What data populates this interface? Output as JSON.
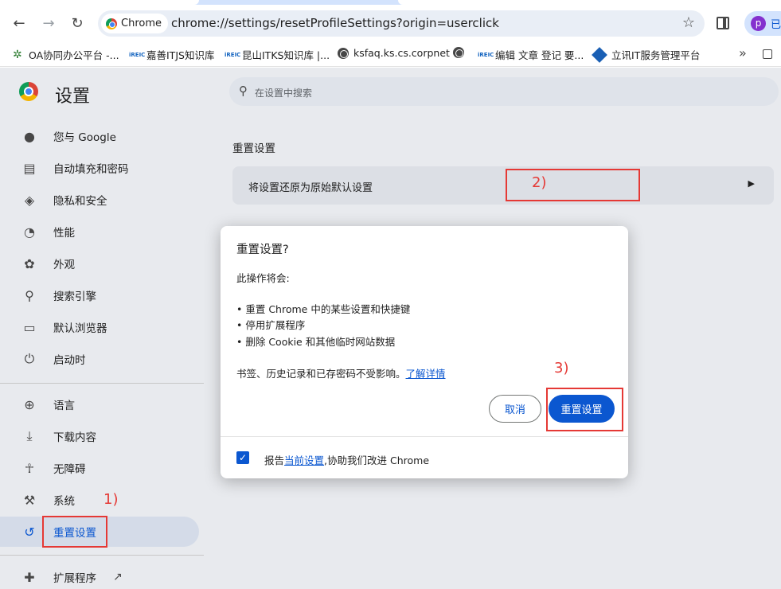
{
  "browser": {
    "chip_label": "Chrome",
    "url": "chrome://settings/resetProfileSettings?origin=userclick",
    "profile_initial": "p",
    "profile_text": "已",
    "icons": {
      "back": "back-arrow-icon",
      "forward": "forward-arrow-icon",
      "reload": "reload-icon",
      "star": "star-icon",
      "side_panel": "side-panel-icon"
    }
  },
  "bookmarks": [
    {
      "label": "OA协同办公平台 -...",
      "icon": "gear-icon"
    },
    {
      "label": "嘉善ITJS知识库",
      "icon": "ireic-icon"
    },
    {
      "label": "昆山ITKS知识库 |...",
      "icon": "ireic-icon"
    },
    {
      "label": "ksfaq.ks.cs.corpnet",
      "icon": "globe-icon"
    },
    {
      "label": "",
      "icon": "globe-icon"
    },
    {
      "label": "编辑 文章 登记 要...",
      "icon": "ireic-icon"
    },
    {
      "label": "立讯IT服务管理平台",
      "icon": "diamond-icon"
    }
  ],
  "bookmarks_more": "»",
  "sidebar": {
    "title": "设置",
    "items": [
      {
        "label": "您与 Google",
        "icon": "person-icon"
      },
      {
        "label": "自动填充和密码",
        "icon": "clipboard-icon"
      },
      {
        "label": "隐私和安全",
        "icon": "shield-icon"
      },
      {
        "label": "性能",
        "icon": "gauge-icon"
      },
      {
        "label": "外观",
        "icon": "palette-icon"
      },
      {
        "label": "搜索引擎",
        "icon": "search-icon"
      },
      {
        "label": "默认浏览器",
        "icon": "browser-icon"
      },
      {
        "label": "启动时",
        "icon": "power-icon"
      },
      {
        "label": "语言",
        "icon": "globe-icon"
      },
      {
        "label": "下载内容",
        "icon": "download-icon"
      },
      {
        "label": "无障碍",
        "icon": "accessibility-icon"
      },
      {
        "label": "系统",
        "icon": "wrench-icon"
      },
      {
        "label": "重置设置",
        "icon": "history-icon"
      },
      {
        "label": "扩展程序",
        "icon": "puzzle-icon"
      }
    ],
    "active_index": 12
  },
  "search": {
    "placeholder": "在设置中搜索"
  },
  "main": {
    "section_title": "重置设置",
    "card_label": "将设置还原为原始默认设置"
  },
  "dialog": {
    "title": "重置设置?",
    "intro": "此操作将会:",
    "items": [
      "• 重置 Chrome 中的某些设置和快捷键",
      "• 停用扩展程序",
      "• 删除 Cookie 和其他临时网站数据"
    ],
    "note": "书签、历史记录和已存密码不受影响。",
    "learn_more": "了解详情",
    "cancel": "取消",
    "confirm": "重置设置",
    "footer_prefix": "报告",
    "footer_link": "当前设置",
    "footer_suffix": ",协助我们改进 Chrome",
    "checkbox_checked": true
  },
  "annotations": {
    "step1": "1)",
    "step2": "2)",
    "step3": "3)",
    "color": "#e53935"
  },
  "colors": {
    "accent": "#0b57d0",
    "page_bg": "#e8eaee"
  }
}
